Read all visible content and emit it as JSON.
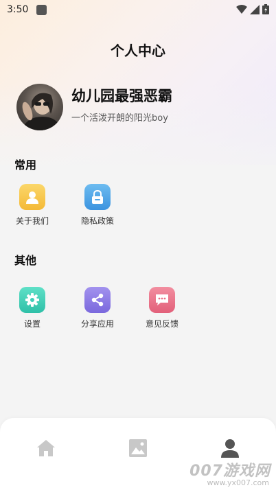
{
  "status_bar": {
    "time": "3:50"
  },
  "header": {
    "title": "个人中心"
  },
  "profile": {
    "name": "幼儿园最强恶霸",
    "bio": "一个活泼开朗的阳光boy"
  },
  "sections": {
    "common": {
      "title": "常用",
      "items": [
        {
          "label": "关于我们",
          "icon": "user-icon",
          "color": "#f7c948"
        },
        {
          "label": "隐私政策",
          "icon": "lock-icon",
          "color": "#4ea6e8"
        }
      ]
    },
    "other": {
      "title": "其他",
      "items": [
        {
          "label": "设置",
          "icon": "gear-icon",
          "color": "#3fcfb8"
        },
        {
          "label": "分享应用",
          "icon": "share-icon",
          "color": "#8a79e6"
        },
        {
          "label": "意见反馈",
          "icon": "message-icon",
          "color": "#ea6f86"
        }
      ]
    }
  },
  "bottom_nav": {
    "items": [
      {
        "icon": "home-icon",
        "active": false
      },
      {
        "icon": "image-icon",
        "active": false
      },
      {
        "icon": "person-icon",
        "active": true
      }
    ]
  },
  "watermark": {
    "brand": "007游戏网",
    "url": "www.yx007.com"
  }
}
